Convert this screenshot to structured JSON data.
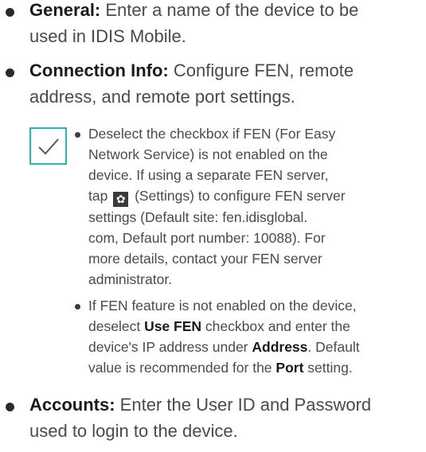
{
  "items": {
    "general": {
      "label": "General:",
      "text": " Enter a name of the device to be",
      "text2": "used in IDIS Mobile."
    },
    "connection": {
      "label": "Connection Info:",
      "text": " Configure FEN, remote",
      "text2": "address, and remote port settings."
    },
    "accounts": {
      "label": "Accounts:",
      "text": " Enter the User ID and Password",
      "text2": "used to login to the device."
    }
  },
  "note": {
    "icon": "checkmark-icon",
    "accent_color": "#2bb3b3",
    "sub1": {
      "l1": "Deselect the checkbox if FEN (For Easy",
      "l2": "Network Service) is not enabled on the",
      "l3": "device. If using a separate FEN server,",
      "l4a": "tap",
      "l4b": "(Settings) to configure FEN server",
      "l5": "settings (Default site: fen.idisglobal.",
      "l6": "com, Default port number: 10088). For",
      "l7": "more details, contact your FEN server",
      "l8": "administrator."
    },
    "sub2": {
      "l1": "If FEN feature is not enabled on the device,",
      "l2a": "deselect",
      "l2b": "Use FEN",
      "l2c": "checkbox and enter the",
      "l3a": "device's IP address under",
      "l3b": "Address",
      "l3c": ". Default",
      "l4a": "value is recommended for the",
      "l4b": "Port",
      "l4c": "setting."
    }
  }
}
